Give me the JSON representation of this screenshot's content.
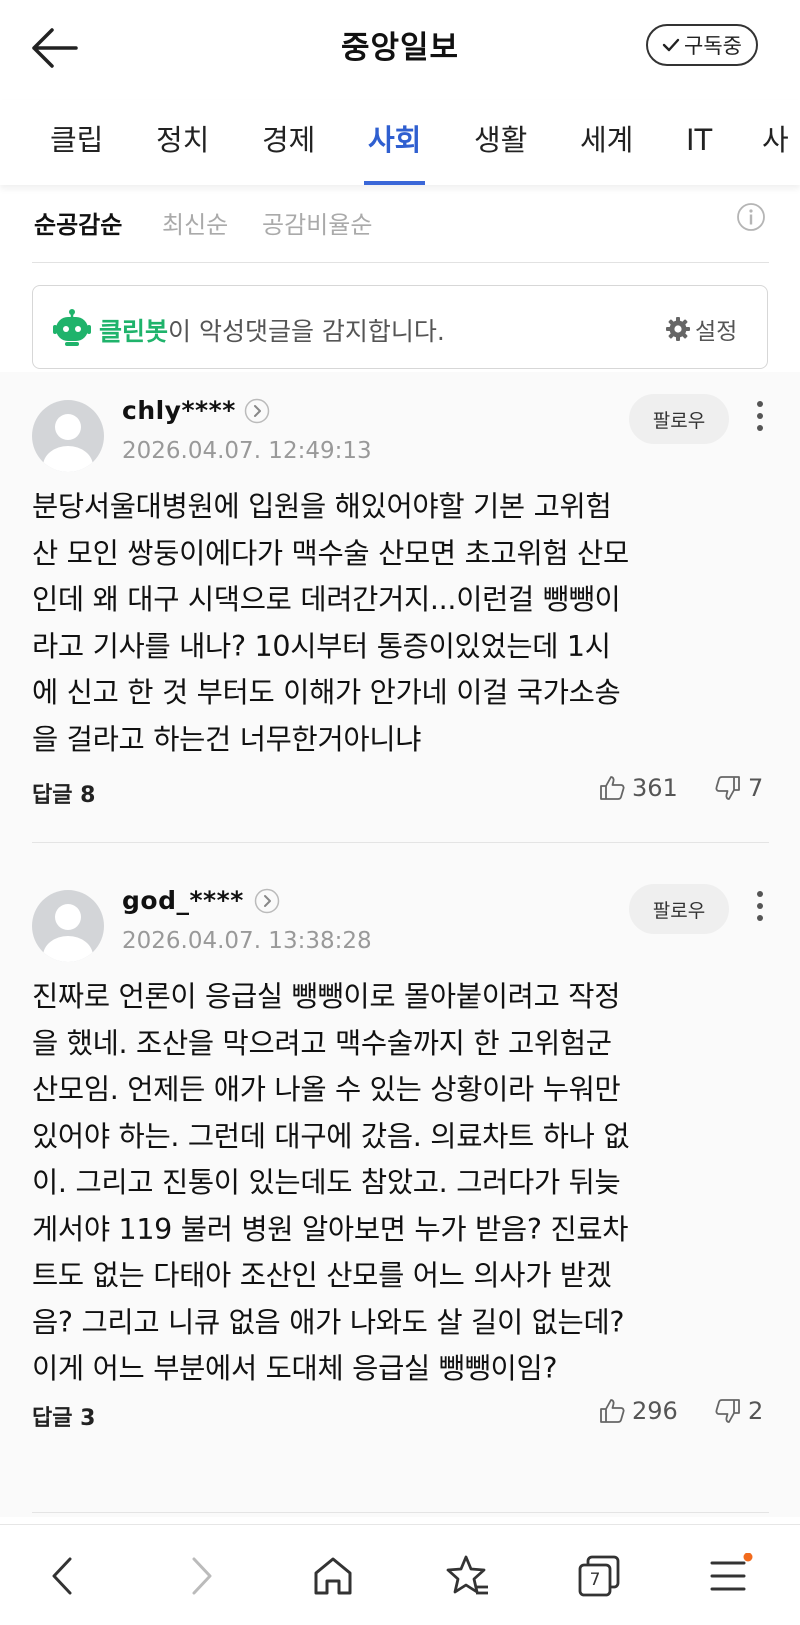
{
  "header": {
    "title": "중앙일보",
    "subscribe_label": "구독중",
    "back_icon": "back-arrow-icon",
    "check_icon": "check-icon"
  },
  "tabs": [
    {
      "label": "클립",
      "active": false
    },
    {
      "label": "정치",
      "active": false
    },
    {
      "label": "경제",
      "active": false
    },
    {
      "label": "사회",
      "active": true
    },
    {
      "label": "생활",
      "active": false
    },
    {
      "label": "세계",
      "active": false
    },
    {
      "label": "IT",
      "active": false
    },
    {
      "label": "사",
      "active": false
    }
  ],
  "sort": {
    "options": [
      "순공감순",
      "최신순",
      "공감비율순"
    ],
    "selected": "순공감순"
  },
  "cleanbot": {
    "brand": "클린봇",
    "message": "이 악성댓글을 감지합니다.",
    "settings_label": "설정"
  },
  "comments": [
    {
      "username": "chly****",
      "timestamp": "2026.04.07. 12:49:13",
      "follow_label": "팔로우",
      "lines": [
        "분당서울대병원에 입원을 해있어야할 기본 고위험",
        "산 모인 쌍둥이에다가 맥수술 산모면 초고위험 산모",
        "인데 왜 대구 시댁으로 데려간거지...이런걸 뺑뺑이",
        "라고 기사를 내나? 10시부터 통증이있었는데 1시",
        "에 신고 한 것 부터도 이해가 안가네 이걸 국가소송",
        "을 걸라고 하는건 너무한거아니냐"
      ],
      "reply_label": "답글 8",
      "likes": "361",
      "dislikes": "7"
    },
    {
      "username": "god_****",
      "timestamp": "2026.04.07. 13:38:28",
      "follow_label": "팔로우",
      "lines": [
        "진짜로 언론이 응급실 뺑뺑이로 몰아붙이려고 작정",
        "을 했네. 조산을 막으려고 맥수술까지 한 고위험군",
        "산모임. 언제든 애가 나올 수 있는 상황이라 누워만",
        "있어야 하는. 그런데 대구에 갔음. 의료차트 하나 없",
        "이. 그리고 진통이 있는데도 참았고. 그러다가 뒤늦",
        "게서야 119 불러 병원 알아보면 누가 받음? 진료차",
        "트도 없는 다태아 조산인 산모를 어느 의사가 받겠",
        "음? 그리고 니큐 없음 애가 나와도 살 길이 없는데?",
        "이게 어느 부분에서 도대체 응급실 뺑뺑이임?"
      ],
      "reply_label": "답글 3",
      "likes": "296",
      "dislikes": "2"
    }
  ],
  "bottom_nav": {
    "items": [
      "back-icon",
      "forward-icon",
      "home-icon",
      "favorites-icon",
      "tabs-icon",
      "menu-icon"
    ],
    "tab_count": "7",
    "badge_color": "#f26b1d"
  },
  "colors": {
    "accent": "#2f5fd0",
    "cleanbot_green": "#1fb36b"
  }
}
